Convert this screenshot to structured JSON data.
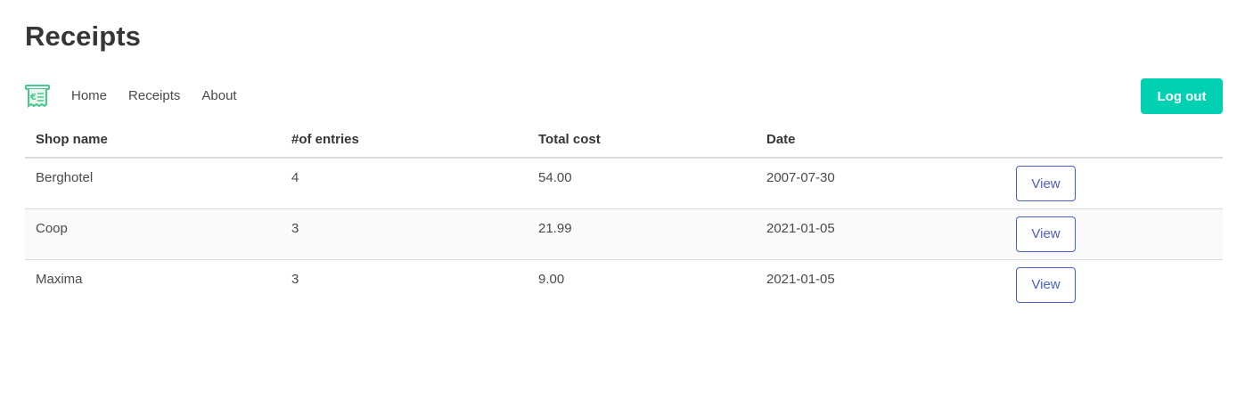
{
  "page": {
    "title": "Receipts"
  },
  "nav": {
    "logo_icon": "receipt-euro-icon",
    "items": [
      {
        "label": "Home"
      },
      {
        "label": "Receipts"
      },
      {
        "label": "About"
      }
    ],
    "logout_label": "Log out"
  },
  "colors": {
    "accent": "#00d1b2",
    "link": "#485fc7",
    "logo": "#48c78e"
  },
  "table": {
    "headers": [
      "Shop name",
      "#of entries",
      "Total cost",
      "Date",
      ""
    ],
    "rows": [
      {
        "shop": "Berghotel",
        "entries": "4",
        "cost": "54.00",
        "date": "2007-07-30",
        "action": "View"
      },
      {
        "shop": "Coop",
        "entries": "3",
        "cost": "21.99",
        "date": "2021-01-05",
        "action": "View"
      },
      {
        "shop": "Maxima",
        "entries": "3",
        "cost": "9.00",
        "date": "2021-01-05",
        "action": "View"
      }
    ]
  }
}
